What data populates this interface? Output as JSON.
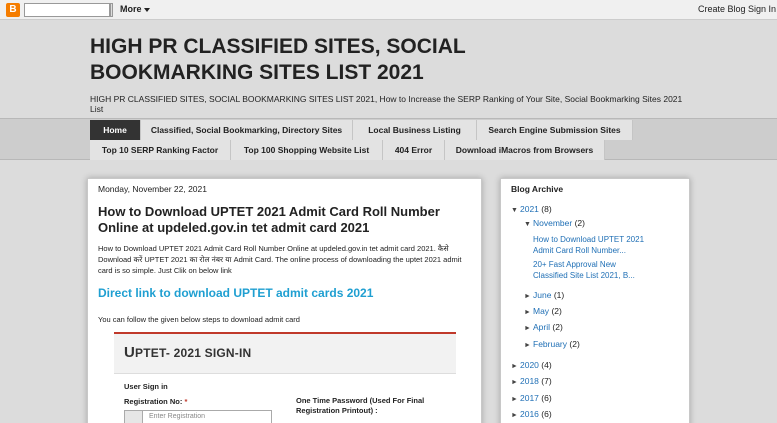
{
  "navbar": {
    "more_label": "More",
    "create_blog": "Create Blog",
    "sign_in": "Sign In",
    "logo_letter": "B"
  },
  "header": {
    "title": "HIGH PR CLASSIFIED SITES, SOCIAL BOOKMARKING SITES LIST 2021",
    "description": "HIGH PR CLASSIFIED SITES, SOCIAL BOOKMARKING SITES LIST 2021, How to Increase the SERP Ranking of Your Site, Social Bookmarking Sites 2021 List"
  },
  "tabs": [
    {
      "label": "Home"
    },
    {
      "label": "Classified, Social Bookmarking, Directory Sites"
    },
    {
      "label": "Local Business Listing"
    },
    {
      "label": "Search Engine Submission Sites"
    },
    {
      "label": "Top 10 SERP Ranking Factor"
    },
    {
      "label": "Top 100 Shopping Website List"
    },
    {
      "label": "404 Error"
    },
    {
      "label": "Download iMacros from Browsers"
    }
  ],
  "post": {
    "date": "Monday, November 22, 2021",
    "title": "How to Download UPTET 2021 Admit Card Roll Number Online at updeled.gov.in tet admit card 2021",
    "body": "How to Download UPTET 2021 Admit Card Roll Number Online at updeled.gov.in tet admit card 2021. कैसे Download करें UPTET 2021 का रोल नंबर या Admit Card. The online process of downloading the uptet 2021 admit card is so simple. Just Clik on below link",
    "link": "Direct link to download UPTET admit cards 2021",
    "steps": "You can follow  the given below steps to download admit card",
    "form": {
      "title_first": "U",
      "title_rest": "PTET- 2021 SIGN-IN",
      "user_signin": "User Sign in",
      "reg_label": "Registration No:",
      "reg_required": "*",
      "reg_placeholder": "Enter Registration",
      "otp_label": "One Time Password (Used For Final Registration Printout) :"
    }
  },
  "sidebar": {
    "title": "Blog Archive",
    "archive": [
      {
        "toggle": "▼",
        "label": "2021",
        "count": "(8)"
      },
      {
        "toggle": "▼",
        "label": "November",
        "count": "(2)"
      },
      {
        "toggle": "►",
        "label": "June",
        "count": "(1)"
      },
      {
        "toggle": "►",
        "label": "May",
        "count": "(2)"
      },
      {
        "toggle": "►",
        "label": "April",
        "count": "(2)"
      },
      {
        "toggle": "►",
        "label": "February",
        "count": "(2)"
      },
      {
        "toggle": "►",
        "label": "2020",
        "count": "(4)"
      },
      {
        "toggle": "►",
        "label": "2018",
        "count": "(7)"
      },
      {
        "toggle": "►",
        "label": "2017",
        "count": "(6)"
      },
      {
        "toggle": "►",
        "label": "2016",
        "count": "(6)"
      }
    ],
    "posts": [
      {
        "line1": "How to Download UPTET 2021",
        "line2": "Admit Card Roll Number..."
      },
      {
        "line1": "20+ Fast Approval New",
        "line2": "Classified Site List 2021, B..."
      }
    ]
  },
  "colors": {
    "link": "#1f9fd1",
    "accent_red": "#c0392b",
    "active_tab": "#333333"
  }
}
